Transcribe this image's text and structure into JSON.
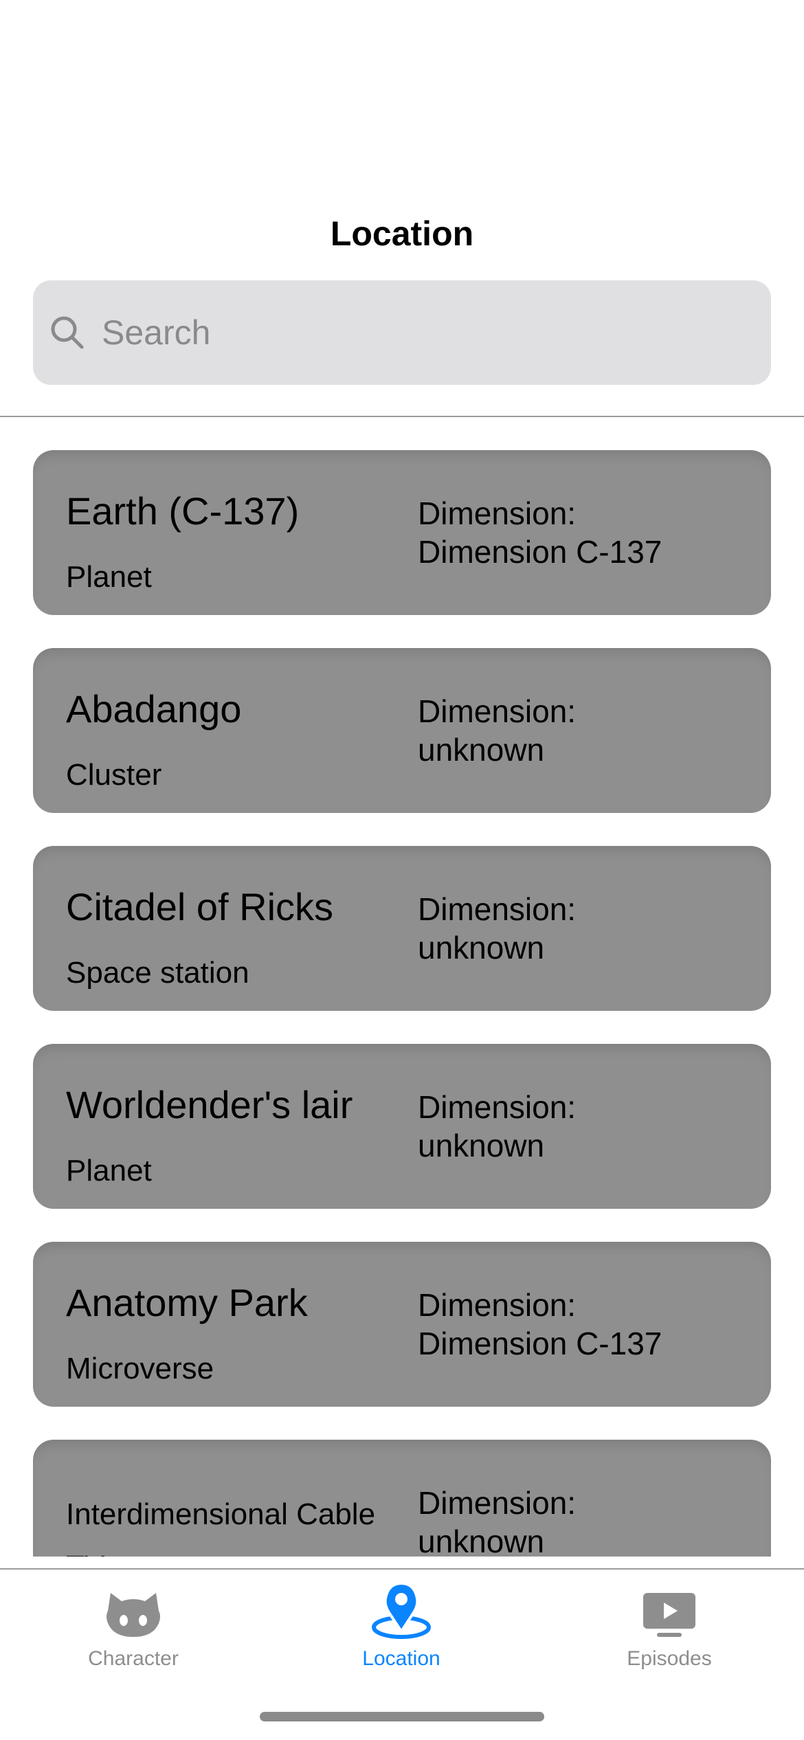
{
  "header": {
    "title": "Location"
  },
  "search": {
    "placeholder": "Search"
  },
  "locations": [
    {
      "name": "Earth (C-137)",
      "type": "Planet",
      "dimension_label": "Dimension:",
      "dimension": "Dimension C-137"
    },
    {
      "name": "Abadango",
      "type": "Cluster",
      "dimension_label": "Dimension:",
      "dimension": "unknown"
    },
    {
      "name": "Citadel of Ricks",
      "type": "Space station",
      "dimension_label": "Dimension:",
      "dimension": "unknown"
    },
    {
      "name": "Worldender's lair",
      "type": "Planet",
      "dimension_label": "Dimension:",
      "dimension": "unknown"
    },
    {
      "name": "Anatomy Park",
      "type": "Microverse",
      "dimension_label": "Dimension:",
      "dimension": "Dimension C-137"
    },
    {
      "name": "Interdimensional Cable",
      "type": "TV",
      "dimension_label": "Dimension:",
      "dimension": "unknown"
    }
  ],
  "tabbar": {
    "tabs": [
      {
        "label": "Character",
        "icon": "github-cat-icon",
        "active": false
      },
      {
        "label": "Location",
        "icon": "map-pin-icon",
        "active": true
      },
      {
        "label": "Episodes",
        "icon": "play-tv-icon",
        "active": false
      }
    ]
  },
  "colors": {
    "accent": "#0a84ff",
    "card": "#8f8f8f",
    "search_bg": "#e0e0e2",
    "inactive_tab": "#8e8e8e"
  }
}
